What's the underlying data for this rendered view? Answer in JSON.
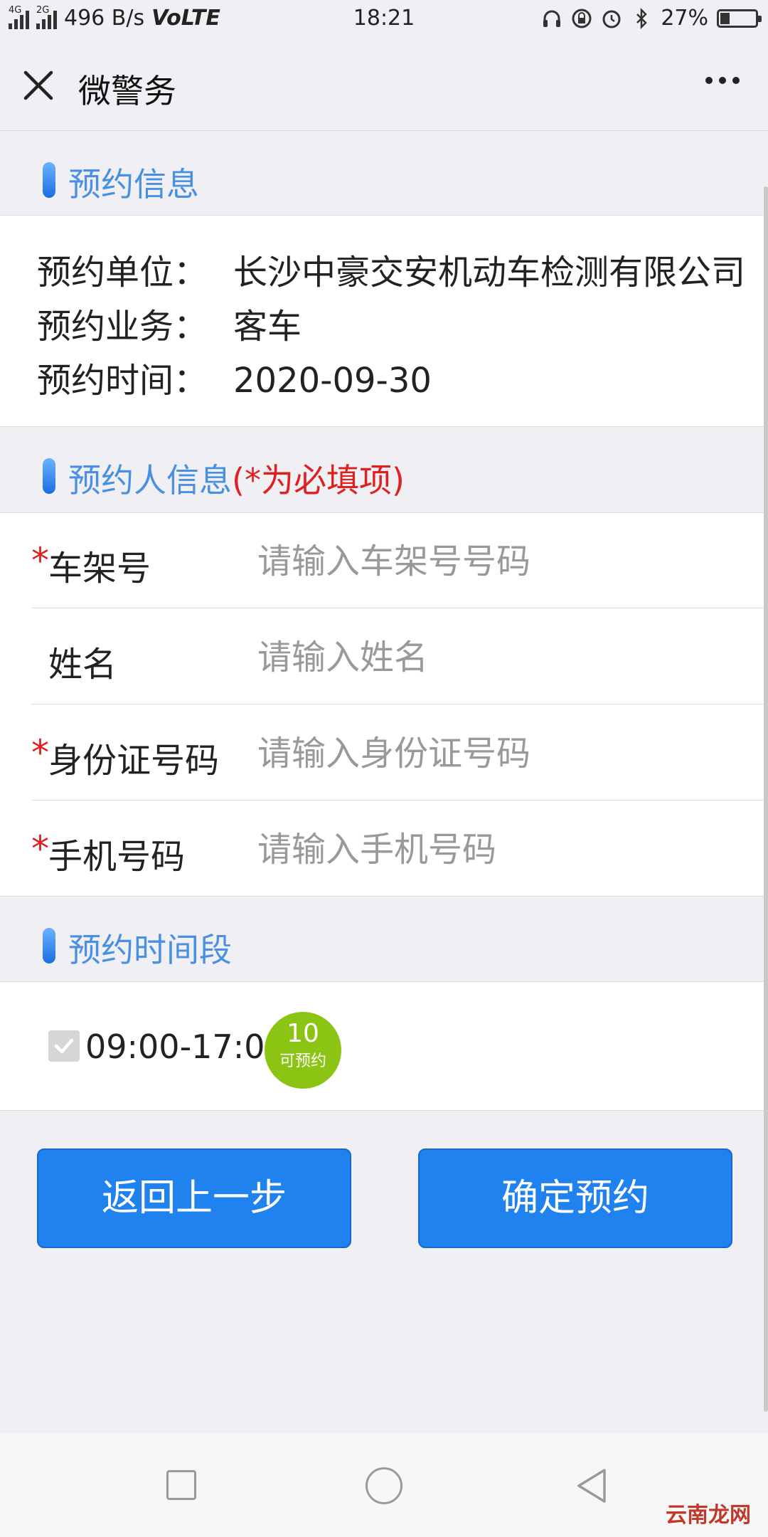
{
  "status_bar": {
    "network_left": "4G",
    "network_right": "2G",
    "speed": "496 B/s",
    "volte": "VoLTE",
    "time": "18:21",
    "battery": "27%",
    "battery_level": 0.27
  },
  "title_bar": {
    "title": "微警务"
  },
  "sections": {
    "appointment_info": "预约信息",
    "applicant_info": "预约人信息",
    "required_hint": "(*为必填项)",
    "time_slot": "预约时间段"
  },
  "appointment_info": [
    {
      "label": "预约单位：",
      "value": "长沙中豪交安机动车检测有限公司"
    },
    {
      "label": "预约业务：",
      "value": "客车"
    },
    {
      "label": "预约时间：",
      "value": "2020-09-30"
    }
  ],
  "form_fields": [
    {
      "required": "*",
      "label": "车架号",
      "value": "",
      "placeholder": "请输入车架号号码"
    },
    {
      "required": "",
      "label": "姓名",
      "value": "",
      "placeholder": "请输入姓名"
    },
    {
      "required": "*",
      "label": "身份证号码",
      "value": "",
      "placeholder": "请输入身份证号码"
    },
    {
      "required": "*",
      "label": "手机号码",
      "value": "",
      "placeholder": "请输入手机号码"
    }
  ],
  "time_slot": {
    "time": "09:00-17:00",
    "available_count": "10",
    "available_label": "可预约",
    "checked": true
  },
  "buttons": {
    "back": "返回上一步",
    "confirm": "确定预约"
  },
  "watermark": "云南龙网",
  "colors": {
    "accent": "#4a90e2",
    "button": "#1f82ee",
    "required": "#e02020",
    "badge": "#8cc414"
  }
}
